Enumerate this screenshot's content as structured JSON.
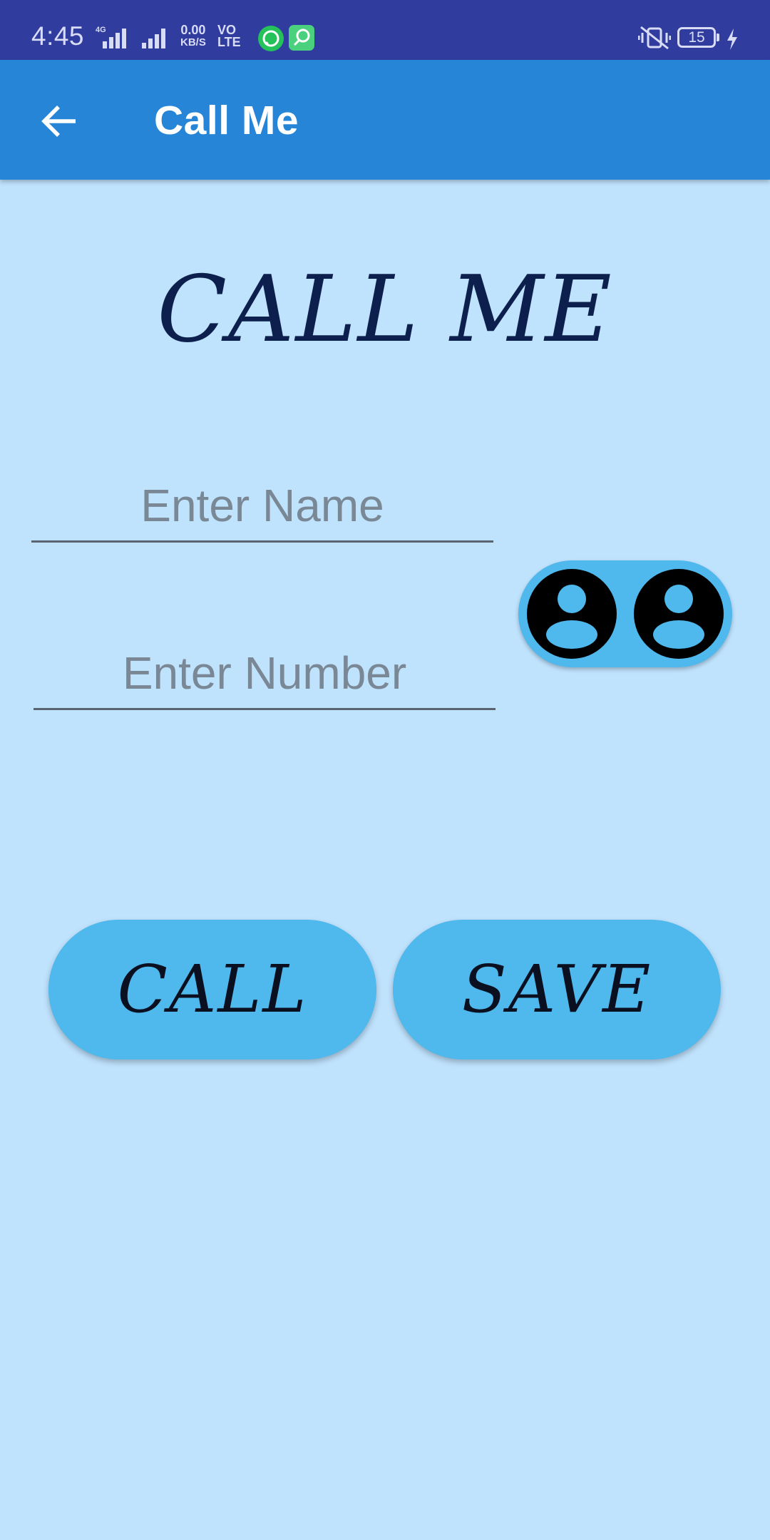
{
  "status_bar": {
    "time": "4:45",
    "network_label": "4G",
    "speed_value": "0.00",
    "speed_unit": "KB/S",
    "volte_top": "VO",
    "volte_bottom": "LTE",
    "battery_level": "15",
    "icons": [
      "signal-icon",
      "signal-icon-2",
      "whatsapp-icon",
      "app-notification-icon",
      "vibrate-icon",
      "battery-icon",
      "charging-icon"
    ]
  },
  "app_bar": {
    "title": "Call Me",
    "back_icon": "arrow-left-icon"
  },
  "main": {
    "heading": "CALL ME",
    "name_field": {
      "placeholder": "Enter Name",
      "value": ""
    },
    "number_field": {
      "placeholder": "Enter Number",
      "value": ""
    },
    "contacts_button": {
      "icons": [
        "account-circle-icon",
        "account-circle-icon"
      ]
    },
    "call_button": "CALL",
    "save_button": "SAVE"
  },
  "colors": {
    "status_bar": "#303d9f",
    "app_bar": "#2685d6",
    "background": "#bfe2fd",
    "button": "#4fb8ec",
    "heading": "#0d1f4c"
  }
}
